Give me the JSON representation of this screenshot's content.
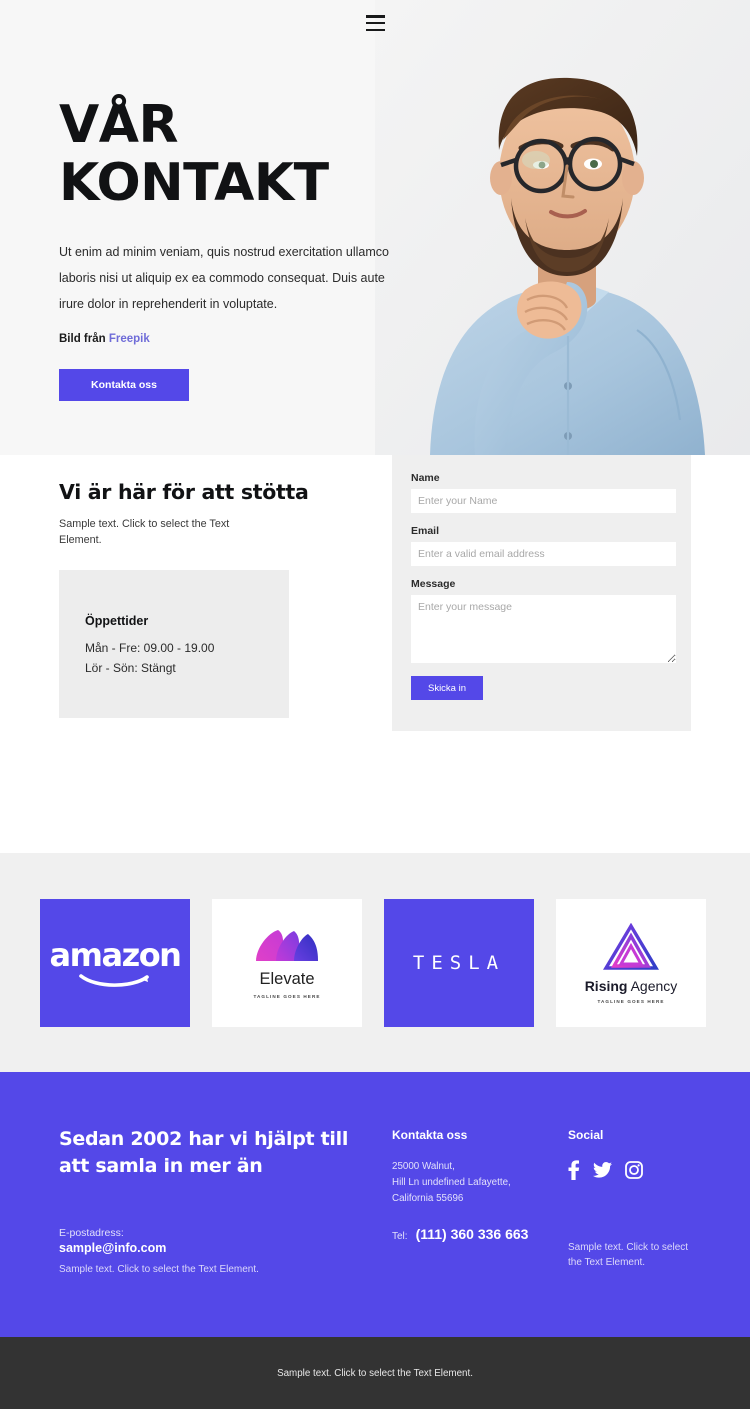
{
  "hero": {
    "menu_icon": "hamburger-menu-icon",
    "title_line1": "VÅR",
    "title_line2": "KONTAKT",
    "paragraph": "Ut enim ad minim veniam, quis nostrud exercitation ullamco laboris nisi ut aliquip ex ea commodo consequat. Duis aute irure dolor in reprehenderit in voluptate.",
    "credit_prefix": "Bild från",
    "credit_link": "Freepik",
    "cta_label": "Kontakta oss"
  },
  "support": {
    "title": "Vi är här för att stötta",
    "subtitle": "Sample text. Click to select the Text Element.",
    "hours_title": "Öppettider",
    "hours_weekday": "Mån - Fre: 09.00 - 19.00",
    "hours_weekend": "Lör - Sön: Stängt"
  },
  "form": {
    "name_label": "Name",
    "name_placeholder": "Enter your Name",
    "name_value": "",
    "email_label": "Email",
    "email_placeholder": "Enter a valid email address",
    "email_value": "",
    "message_label": "Message",
    "message_placeholder": "Enter your message",
    "message_value": "",
    "submit_label": "Skicka in"
  },
  "logos": [
    {
      "name": "amazon",
      "text": "amazon",
      "style": "purple"
    },
    {
      "name": "elevate",
      "text": "Elevate",
      "tagline": "TAGLINE GOES HERE",
      "style": "white"
    },
    {
      "name": "tesla",
      "text": "TESLA",
      "style": "purple"
    },
    {
      "name": "rising-agency",
      "text_bold": "Rising",
      "text_light": "Agency",
      "tagline": "TAGLINE GOES HERE",
      "style": "white"
    }
  ],
  "footer": {
    "headline": "Sedan 2002 har vi hjälpt till att samla in mer än",
    "email_label": "E-postadress:",
    "email": "sample@info.com",
    "note_left": "Sample text. Click to select the Text Element.",
    "contact_title": "Kontakta oss",
    "address_line1": "25000 Walnut,",
    "address_line2": "Hill Ln undefined Lafayette,",
    "address_line3": "California 55696",
    "tel_label": "Tel:",
    "tel_number": "(111) 360 336 663",
    "social_title": "Social",
    "social_icons": [
      "facebook-icon",
      "twitter-icon",
      "instagram-icon"
    ],
    "note_right": "Sample text. Click to select the Text Element."
  },
  "bottombar": {
    "text": "Sample text. Click to select the Text Element."
  },
  "colors": {
    "accent_purple": "#5448E8",
    "link_purple": "#6f6cd8",
    "hero_bg": "#f7f7f7",
    "logos_bg": "#f0f0f0",
    "hours_bg": "#ededed",
    "form_bg": "#efefef",
    "bottombar_bg": "#333333"
  }
}
